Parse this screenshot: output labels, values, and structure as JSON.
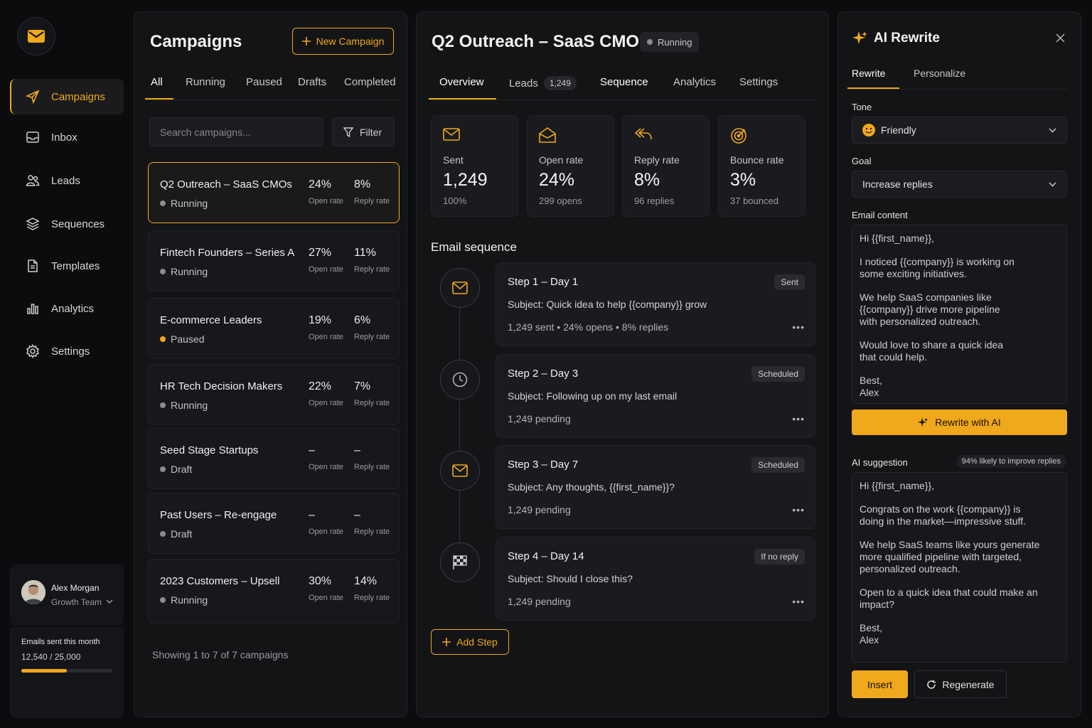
{
  "nav": {
    "items": [
      {
        "label": "Campaigns",
        "icon": "send-icon",
        "active": true
      },
      {
        "label": "Inbox",
        "icon": "inbox-icon"
      },
      {
        "label": "Leads",
        "icon": "users-icon"
      },
      {
        "label": "Sequences",
        "icon": "layers-icon"
      },
      {
        "label": "Templates",
        "icon": "document-icon"
      },
      {
        "label": "Analytics",
        "icon": "bar-chart-icon"
      },
      {
        "label": "Settings",
        "icon": "gear-icon"
      }
    ],
    "user": {
      "name": "Alex Morgan",
      "team": "Growth Team"
    },
    "usage": {
      "label": "Emails sent this month",
      "value": "12,540 / 25,000",
      "fraction": 0.5016
    }
  },
  "campaigns": {
    "title": "Campaigns",
    "new_button": "New Campaign",
    "tabs": [
      "All",
      "Running",
      "Paused",
      "Drafts",
      "Completed"
    ],
    "search_placeholder": "Search campaigns...",
    "filter_label": "Filter",
    "items": [
      {
        "name": "Q2 Outreach – SaaS CMOs",
        "status": "Running",
        "open": "24%",
        "reply": "8%",
        "open_label": "Open rate",
        "reply_label": "Reply rate"
      },
      {
        "name": "Fintech Founders – Series A",
        "status": "Running",
        "open": "27%",
        "reply": "11%",
        "open_label": "Open rate",
        "reply_label": "Reply rate"
      },
      {
        "name": "E-commerce Leaders",
        "status": "Paused",
        "open": "19%",
        "reply": "6%",
        "open_label": "Open rate",
        "reply_label": "Reply rate"
      },
      {
        "name": "HR Tech Decision Makers",
        "status": "Running",
        "open": "22%",
        "reply": "7%",
        "open_label": "Open rate",
        "reply_label": "Reply rate"
      },
      {
        "name": "Seed Stage Startups",
        "status": "Draft",
        "open": "–",
        "reply": "–",
        "open_label": "Open rate",
        "reply_label": "Reply rate"
      },
      {
        "name": "Past Users – Re-engage",
        "status": "Draft",
        "open": "–",
        "reply": "–",
        "open_label": "Open rate",
        "reply_label": "Reply rate"
      },
      {
        "name": "2023 Customers – Upsell",
        "status": "Running",
        "open": "30%",
        "reply": "14%",
        "open_label": "Open rate",
        "reply_label": "Reply rate"
      }
    ],
    "footer": "Showing 1 to 7 of 7 campaigns"
  },
  "detail": {
    "title": "Q2 Outreach – SaaS CMOs",
    "status": "Running",
    "tabs": [
      {
        "label": "Overview"
      },
      {
        "label": "Leads",
        "count": "1,249"
      },
      {
        "label": "Sequence"
      },
      {
        "label": "Analytics"
      },
      {
        "label": "Settings"
      }
    ],
    "stats": [
      {
        "label": "Sent",
        "value": "1,249",
        "sub": "100%",
        "icon": "mail-icon"
      },
      {
        "label": "Open rate",
        "value": "24%",
        "sub": "299 opens",
        "icon": "mail-open-icon"
      },
      {
        "label": "Reply rate",
        "value": "8%",
        "sub": "96 replies",
        "icon": "reply-icon"
      },
      {
        "label": "Bounce rate",
        "value": "3%",
        "sub": "37 bounced",
        "icon": "target-icon"
      }
    ],
    "sequence_title": "Email sequence",
    "steps": [
      {
        "title": "Step 1 – Day 1",
        "badge": "Sent",
        "subject": "Subject: Quick idea to help {{company}} grow",
        "meta": "1,249 sent  •  24% opens  •  8% replies",
        "icon": "mail-icon"
      },
      {
        "title": "Step 2 – Day 3",
        "badge": "Scheduled",
        "subject": "Subject: Following up on my last email",
        "meta": "1,249  pending",
        "icon": "clock-icon"
      },
      {
        "title": "Step 3 – Day 7",
        "badge": "Scheduled",
        "subject": "Subject: Any thoughts, {{first_name}}?",
        "meta": "1,249  pending",
        "icon": "mail-icon"
      },
      {
        "title": "Step 4 – Day 14",
        "badge": "If no reply",
        "subject": "Subject: Should I close this?",
        "meta": "1,249  pending",
        "icon": "flag-icon"
      }
    ],
    "add_step": "Add Step"
  },
  "ai": {
    "title": "AI Rewrite",
    "tabs": [
      "Rewrite",
      "Personalize"
    ],
    "tone_label": "Tone",
    "tone_value": "Friendly",
    "goal_label": "Goal",
    "goal_value": "Increase replies",
    "content_label": "Email content",
    "content": [
      "Hi {{first_name}},",
      "I noticed {{company}} is working on\nsome exciting initiatives.",
      "We help SaaS companies like\n{{company}} drive more pipeline\nwith personalized outreach.",
      "Would love to share a quick idea\nthat could help.",
      "Best,\nAlex"
    ],
    "rewrite_button": "Rewrite with AI",
    "suggestion_label": "AI suggestion",
    "suggestion_badge": "94% likely to improve replies",
    "suggestion": [
      "Hi {{first_name}},",
      "Congrats on the work {{company}} is\ndoing in the market—impressive stuff.",
      "We help SaaS teams like yours generate\nmore qualified pipeline with targeted,\npersonalized outreach.",
      "Open to a quick idea that could make an\nimpact?",
      "Best,\nAlex"
    ],
    "insert_button": "Insert",
    "regenerate_button": "Regenerate"
  },
  "colors": {
    "accent": "#f0a81c",
    "background": "#0b0c0e",
    "panel": "#131416"
  }
}
